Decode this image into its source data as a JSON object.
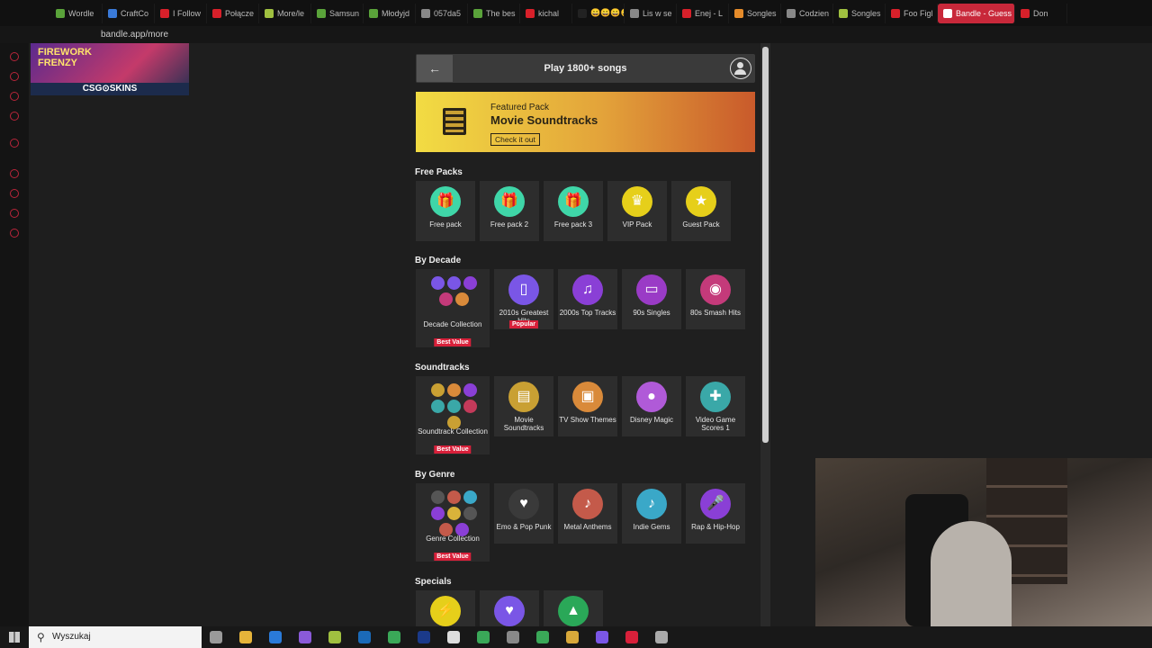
{
  "browser": {
    "tabs": [
      {
        "label": "Wordle",
        "color": "#5aa33a"
      },
      {
        "label": "CraftCo",
        "color": "#3a7ad8"
      },
      {
        "label": "I Follow",
        "color": "#d8202a"
      },
      {
        "label": "Połącze",
        "color": "#d8202a"
      },
      {
        "label": "More/le",
        "color": "#a0c040"
      },
      {
        "label": "Samsun",
        "color": "#5aa33a"
      },
      {
        "label": "Młodyjd",
        "color": "#5aa33a"
      },
      {
        "label": "057da5",
        "color": "#888888"
      },
      {
        "label": "The bes",
        "color": "#5aa33a"
      },
      {
        "label": "kichal",
        "color": "#d8202a"
      },
      {
        "label": "😀😀😀😀",
        "color": "#222222"
      },
      {
        "label": "Lis w se",
        "color": "#888888"
      },
      {
        "label": "Enej - L",
        "color": "#d8202a"
      },
      {
        "label": "Songles",
        "color": "#e58b2a"
      },
      {
        "label": "Codzien",
        "color": "#888888"
      },
      {
        "label": "Songles",
        "color": "#a0c040"
      },
      {
        "label": "Foo Figl",
        "color": "#d8202a"
      },
      {
        "label": "Bandle - Guess",
        "color": "#ffffff",
        "active": true
      },
      {
        "label": "Don",
        "color": "#d8202a"
      }
    ],
    "url": "bandle.app/more"
  },
  "ad": {
    "line1": "FIREWORK",
    "line2": "FRENZY",
    "brand": "CSG⊙SKINS"
  },
  "header": {
    "back_icon": "←",
    "title": "Play 1800+ songs"
  },
  "featured": {
    "kicker": "Featured Pack",
    "name": "Movie Soundtracks",
    "cta": "Check it out"
  },
  "sections": {
    "free": {
      "title": "Free Packs",
      "items": [
        {
          "label": "Free pack",
          "icon": "gift-icon",
          "glyph": "🎁",
          "color": "#3fd6a8"
        },
        {
          "label": "Free pack 2",
          "icon": "gift-icon",
          "glyph": "🎁",
          "color": "#3fd6a8"
        },
        {
          "label": "Free pack 3",
          "icon": "gift-icon",
          "glyph": "🎁",
          "color": "#3fd6a8"
        },
        {
          "label": "VIP Pack",
          "icon": "crown-icon",
          "glyph": "♛",
          "color": "#e6cf1a"
        },
        {
          "label": "Guest Pack",
          "icon": "ticket-icon",
          "glyph": "★",
          "color": "#e6cf1a"
        }
      ]
    },
    "decade": {
      "title": "By Decade",
      "collection": {
        "label": "Decade Collection",
        "badge": "Best Value",
        "minis": [
          "#7a56e6",
          "#7a56e6",
          "#8a3fd6",
          "#c43a7a",
          "#d98a3a"
        ]
      },
      "items": [
        {
          "label": "2010s Greatest Hits",
          "icon": "phone-icon",
          "glyph": "▯",
          "color": "#7a56e6",
          "badge": "Popular"
        },
        {
          "label": "2000s Top Tracks",
          "icon": "headphones-icon",
          "glyph": "♫",
          "color": "#8a3fd6"
        },
        {
          "label": "90s Singles",
          "icon": "cassette-icon",
          "glyph": "▭",
          "color": "#9a3bc6"
        },
        {
          "label": "80s Smash Hits",
          "icon": "vinyl-icon",
          "glyph": "◉",
          "color": "#c43a7a"
        }
      ]
    },
    "soundtracks": {
      "title": "Soundtracks",
      "collection": {
        "label": "Soundtrack Collection",
        "badge": "Best Value",
        "minis": [
          "#c9a033",
          "#d98a3a",
          "#8a3fd6",
          "#3aa8a8",
          "#3aa8a8",
          "#c43a5a",
          "#c9a033"
        ]
      },
      "items": [
        {
          "label": "Movie Soundtracks",
          "icon": "film-icon",
          "glyph": "▤",
          "color": "#c9a033"
        },
        {
          "label": "TV Show Themes",
          "icon": "tv-icon",
          "glyph": "▣",
          "color": "#d98a3a"
        },
        {
          "label": "Disney Magic",
          "icon": "mouse-ears-icon",
          "glyph": "●",
          "color": "#b05ad8"
        },
        {
          "label": "Video Game Scores 1",
          "icon": "gamepad-icon",
          "glyph": "✚",
          "color": "#3aa8a8"
        }
      ]
    },
    "genre": {
      "title": "By Genre",
      "collection": {
        "label": "Genre Collection",
        "badge": "Best Value",
        "minis": [
          "#555555",
          "#c45a4a",
          "#3aa8c8",
          "#8a3fd6",
          "#d9b33a",
          "#555555",
          "#c45a4a",
          "#8a3fd6"
        ]
      },
      "items": [
        {
          "label": "Emo & Pop Punk",
          "icon": "broken-heart-icon",
          "glyph": "♥",
          "color": "#3a3a3a"
        },
        {
          "label": "Metal Anthems",
          "icon": "guitar-icon",
          "glyph": "♪",
          "color": "#c45a4a"
        },
        {
          "label": "Indie Gems",
          "icon": "guitar-icon",
          "glyph": "♪",
          "color": "#3aa8c8"
        },
        {
          "label": "Rap & Hip-Hop",
          "icon": "microphone-icon",
          "glyph": "🎤",
          "color": "#8a3fd6"
        }
      ]
    },
    "specials": {
      "title": "Specials",
      "items": [
        {
          "icon": "lightning-icon",
          "glyph": "⚡",
          "color": "#e6cf1a"
        },
        {
          "icon": "heart-icon",
          "glyph": "♥",
          "color": "#7a56e6"
        },
        {
          "icon": "tree-icon",
          "glyph": "▲",
          "color": "#2aa858"
        }
      ]
    }
  },
  "taskbar": {
    "search_placeholder": "Wyszukaj"
  }
}
